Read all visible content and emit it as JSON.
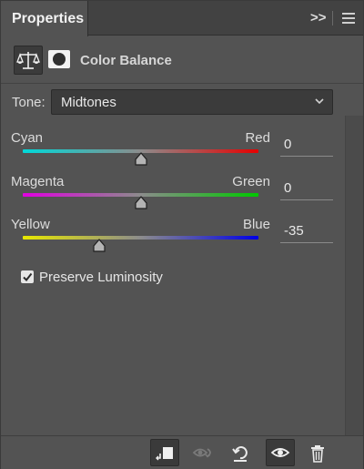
{
  "panel": {
    "tab_title": "Properties",
    "collapse_glyph": ">>",
    "menu_icon": "hamburger-menu-icon"
  },
  "header": {
    "adjustment_icon": "scales-icon",
    "mask_icon": "layer-mask-icon",
    "title": "Color Balance"
  },
  "tone": {
    "label": "Tone:",
    "selected": "Midtones",
    "chevron_icon": "chevron-down-icon"
  },
  "sliders": [
    {
      "left_label": "Cyan",
      "right_label": "Red",
      "value": "0",
      "position_fraction": 0.5,
      "left_color": "#00d8d8",
      "right_color": "#e60000"
    },
    {
      "left_label": "Magenta",
      "right_label": "Green",
      "value": "0",
      "position_fraction": 0.5,
      "left_color": "#e000e0",
      "right_color": "#00c800"
    },
    {
      "left_label": "Yellow",
      "right_label": "Blue",
      "value": "-35",
      "position_fraction": 0.325,
      "left_color": "#e8e800",
      "right_color": "#0000e6"
    }
  ],
  "preserve_luminosity": {
    "label": "Preserve Luminosity",
    "checked": true
  },
  "toolbar": [
    {
      "name": "clip-to-layer-button",
      "icon": "clip-to-layer-icon",
      "active": true
    },
    {
      "name": "view-previous-state-button",
      "icon": "eye-previous-icon",
      "active": false
    },
    {
      "name": "reset-button",
      "icon": "reset-icon",
      "active": false
    },
    {
      "name": "toggle-visibility-button",
      "icon": "eye-icon",
      "active": true
    },
    {
      "name": "delete-button",
      "icon": "trash-icon",
      "active": false
    }
  ]
}
